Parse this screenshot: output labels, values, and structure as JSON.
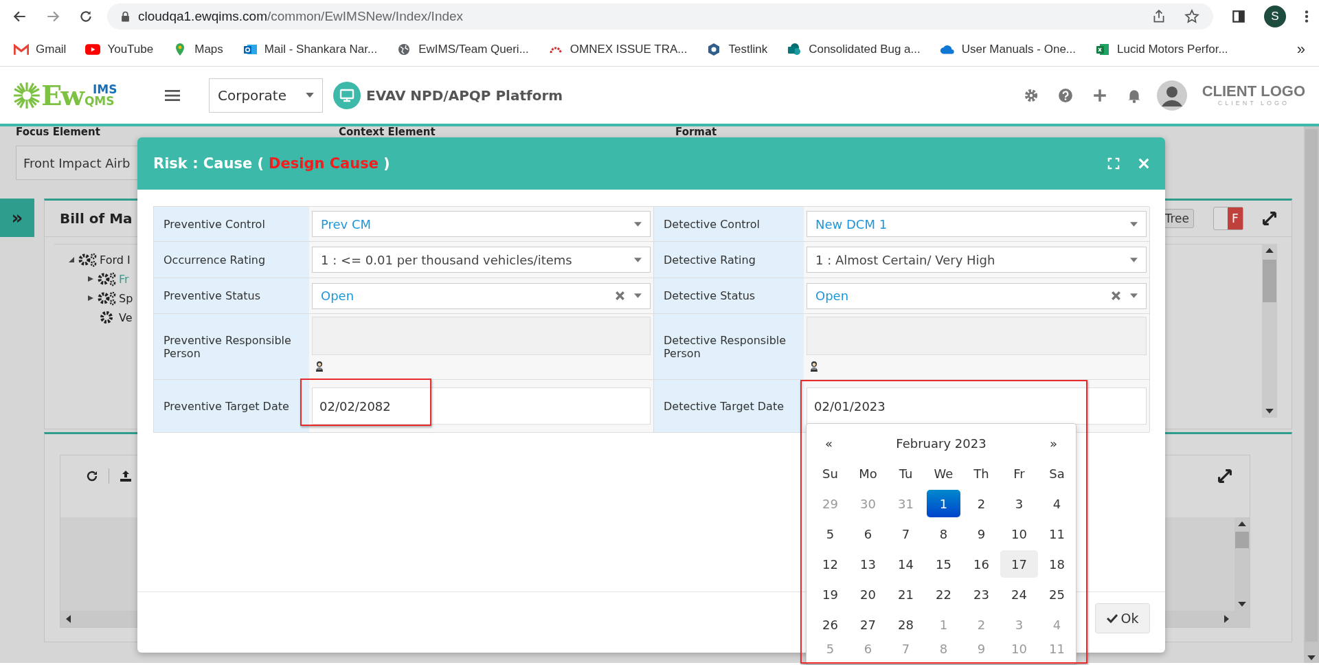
{
  "browser": {
    "url_domain": "cloudqa1.ewqims.com",
    "url_path": "/common/EwIMSNew/Index/Index",
    "profile_initial": "S",
    "more": "»",
    "bookmarks": [
      {
        "label": "Gmail",
        "kind": "gmail"
      },
      {
        "label": "YouTube",
        "kind": "youtube"
      },
      {
        "label": "Maps",
        "kind": "maps"
      },
      {
        "label": "Mail - Shankara Nar...",
        "kind": "outlook"
      },
      {
        "label": "EwIMS/Team Queri...",
        "kind": "globe"
      },
      {
        "label": "OMNEX ISSUE TRA...",
        "kind": "arc"
      },
      {
        "label": "Testlink",
        "kind": "hexagon"
      },
      {
        "label": "Consolidated Bug a...",
        "kind": "sharepoint"
      },
      {
        "label": "User Manuals - One...",
        "kind": "cloud"
      },
      {
        "label": "Lucid Motors Perfor...",
        "kind": "excel"
      }
    ]
  },
  "header": {
    "logo_main": "Ew",
    "logo_top": "IMS",
    "logo_bottom": "QMS",
    "org_select": "Corporate",
    "platform": "EVAV NPD/APQP Platform",
    "client_logo": "CLIENT LOGO",
    "client_logo_sub": "CLIENT LOGO"
  },
  "filters": [
    {
      "label": "Focus Element",
      "value": "Front Impact Airb"
    },
    {
      "label": "Context Element"
    },
    {
      "label": "Format"
    }
  ],
  "sidebar_toggle": "»",
  "bom_panel": {
    "title": "Bill of Ma",
    "view_button": "Tree",
    "toggle_label": "F",
    "tree": [
      {
        "label": "Ford I",
        "kind": "assembly",
        "expanded": true,
        "selected": false,
        "children": [
          {
            "label": "Fr",
            "kind": "assembly",
            "expanded": false,
            "selected": true
          },
          {
            "label": "Sp",
            "kind": "assembly",
            "expanded": false,
            "selected": false
          },
          {
            "label": "Ve",
            "kind": "part",
            "selected": false
          }
        ]
      }
    ]
  },
  "modal": {
    "title": "Risk : Cause (",
    "title_highlight": "Design Cause",
    "title_end": ")",
    "ok_button": "Ok",
    "rows": [
      [
        {
          "label": "Preventive Control",
          "kind": "lookup",
          "value": "Prev CM"
        },
        {
          "label": "Detective Control",
          "kind": "lookup",
          "value": "New DCM 1"
        }
      ],
      [
        {
          "label": "Occurrence Rating",
          "kind": "select",
          "value": "1 : <= 0.01 per thousand vehicles/items"
        },
        {
          "label": "Detective Rating",
          "kind": "select",
          "value": "1 : Almost Certain/ Very High"
        }
      ],
      [
        {
          "label": "Preventive Status",
          "kind": "status",
          "value": "Open"
        },
        {
          "label": "Detective Status",
          "kind": "status",
          "value": "Open"
        }
      ],
      [
        {
          "label": "Preventive Responsible Person",
          "kind": "person"
        },
        {
          "label": "Detective Responsible Person",
          "kind": "person"
        }
      ],
      [
        {
          "label": "Preventive Target Date",
          "kind": "date",
          "value": "02/02/2082",
          "highlighted": true
        },
        {
          "label": "Detective Target Date",
          "kind": "date",
          "value": "02/01/2023",
          "highlighted": true
        }
      ]
    ]
  },
  "datepicker": {
    "prev": "«",
    "title": "February 2023",
    "next": "»",
    "weekdays": [
      "Su",
      "Mo",
      "Tu",
      "We",
      "Th",
      "Fr",
      "Sa"
    ],
    "days": [
      {
        "text": "29",
        "muted": true,
        "selected": false,
        "hovered": false
      },
      {
        "text": "30",
        "muted": true,
        "selected": false,
        "hovered": false
      },
      {
        "text": "31",
        "muted": true,
        "selected": false,
        "hovered": false
      },
      {
        "text": "1",
        "muted": false,
        "selected": true,
        "hovered": false
      },
      {
        "text": "2",
        "muted": false,
        "selected": false,
        "hovered": false
      },
      {
        "text": "3",
        "muted": false,
        "selected": false,
        "hovered": false
      },
      {
        "text": "4",
        "muted": false,
        "selected": false,
        "hovered": false
      },
      {
        "text": "5",
        "muted": false,
        "selected": false,
        "hovered": false
      },
      {
        "text": "6",
        "muted": false,
        "selected": false,
        "hovered": false
      },
      {
        "text": "7",
        "muted": false,
        "selected": false,
        "hovered": false
      },
      {
        "text": "8",
        "muted": false,
        "selected": false,
        "hovered": false
      },
      {
        "text": "9",
        "muted": false,
        "selected": false,
        "hovered": false
      },
      {
        "text": "10",
        "muted": false,
        "selected": false,
        "hovered": false
      },
      {
        "text": "11",
        "muted": false,
        "selected": false,
        "hovered": false
      },
      {
        "text": "12",
        "muted": false,
        "selected": false,
        "hovered": false
      },
      {
        "text": "13",
        "muted": false,
        "selected": false,
        "hovered": false
      },
      {
        "text": "14",
        "muted": false,
        "selected": false,
        "hovered": false
      },
      {
        "text": "15",
        "muted": false,
        "selected": false,
        "hovered": false
      },
      {
        "text": "16",
        "muted": false,
        "selected": false,
        "hovered": false
      },
      {
        "text": "17",
        "muted": false,
        "selected": false,
        "hovered": true
      },
      {
        "text": "18",
        "muted": false,
        "selected": false,
        "hovered": false
      },
      {
        "text": "19",
        "muted": false,
        "selected": false,
        "hovered": false
      },
      {
        "text": "20",
        "muted": false,
        "selected": false,
        "hovered": false
      },
      {
        "text": "21",
        "muted": false,
        "selected": false,
        "hovered": false
      },
      {
        "text": "22",
        "muted": false,
        "selected": false,
        "hovered": false
      },
      {
        "text": "23",
        "muted": false,
        "selected": false,
        "hovered": false
      },
      {
        "text": "24",
        "muted": false,
        "selected": false,
        "hovered": false
      },
      {
        "text": "25",
        "muted": false,
        "selected": false,
        "hovered": false
      },
      {
        "text": "26",
        "muted": false,
        "selected": false,
        "hovered": false
      },
      {
        "text": "27",
        "muted": false,
        "selected": false,
        "hovered": false
      },
      {
        "text": "28",
        "muted": false,
        "selected": false,
        "hovered": false
      },
      {
        "text": "1",
        "muted": true,
        "selected": false,
        "hovered": false
      },
      {
        "text": "2",
        "muted": true,
        "selected": false,
        "hovered": false
      },
      {
        "text": "3",
        "muted": true,
        "selected": false,
        "hovered": false
      },
      {
        "text": "4",
        "muted": true,
        "selected": false,
        "hovered": false
      },
      {
        "text": "5",
        "muted": true,
        "selected": false,
        "hovered": false
      },
      {
        "text": "6",
        "muted": true,
        "selected": false,
        "hovered": false
      },
      {
        "text": "7",
        "muted": true,
        "selected": false,
        "hovered": false
      },
      {
        "text": "8",
        "muted": true,
        "selected": false,
        "hovered": false
      },
      {
        "text": "9",
        "muted": true,
        "selected": false,
        "hovered": false
      },
      {
        "text": "10",
        "muted": true,
        "selected": false,
        "hovered": false
      },
      {
        "text": "11",
        "muted": true,
        "selected": false,
        "hovered": false
      }
    ]
  }
}
